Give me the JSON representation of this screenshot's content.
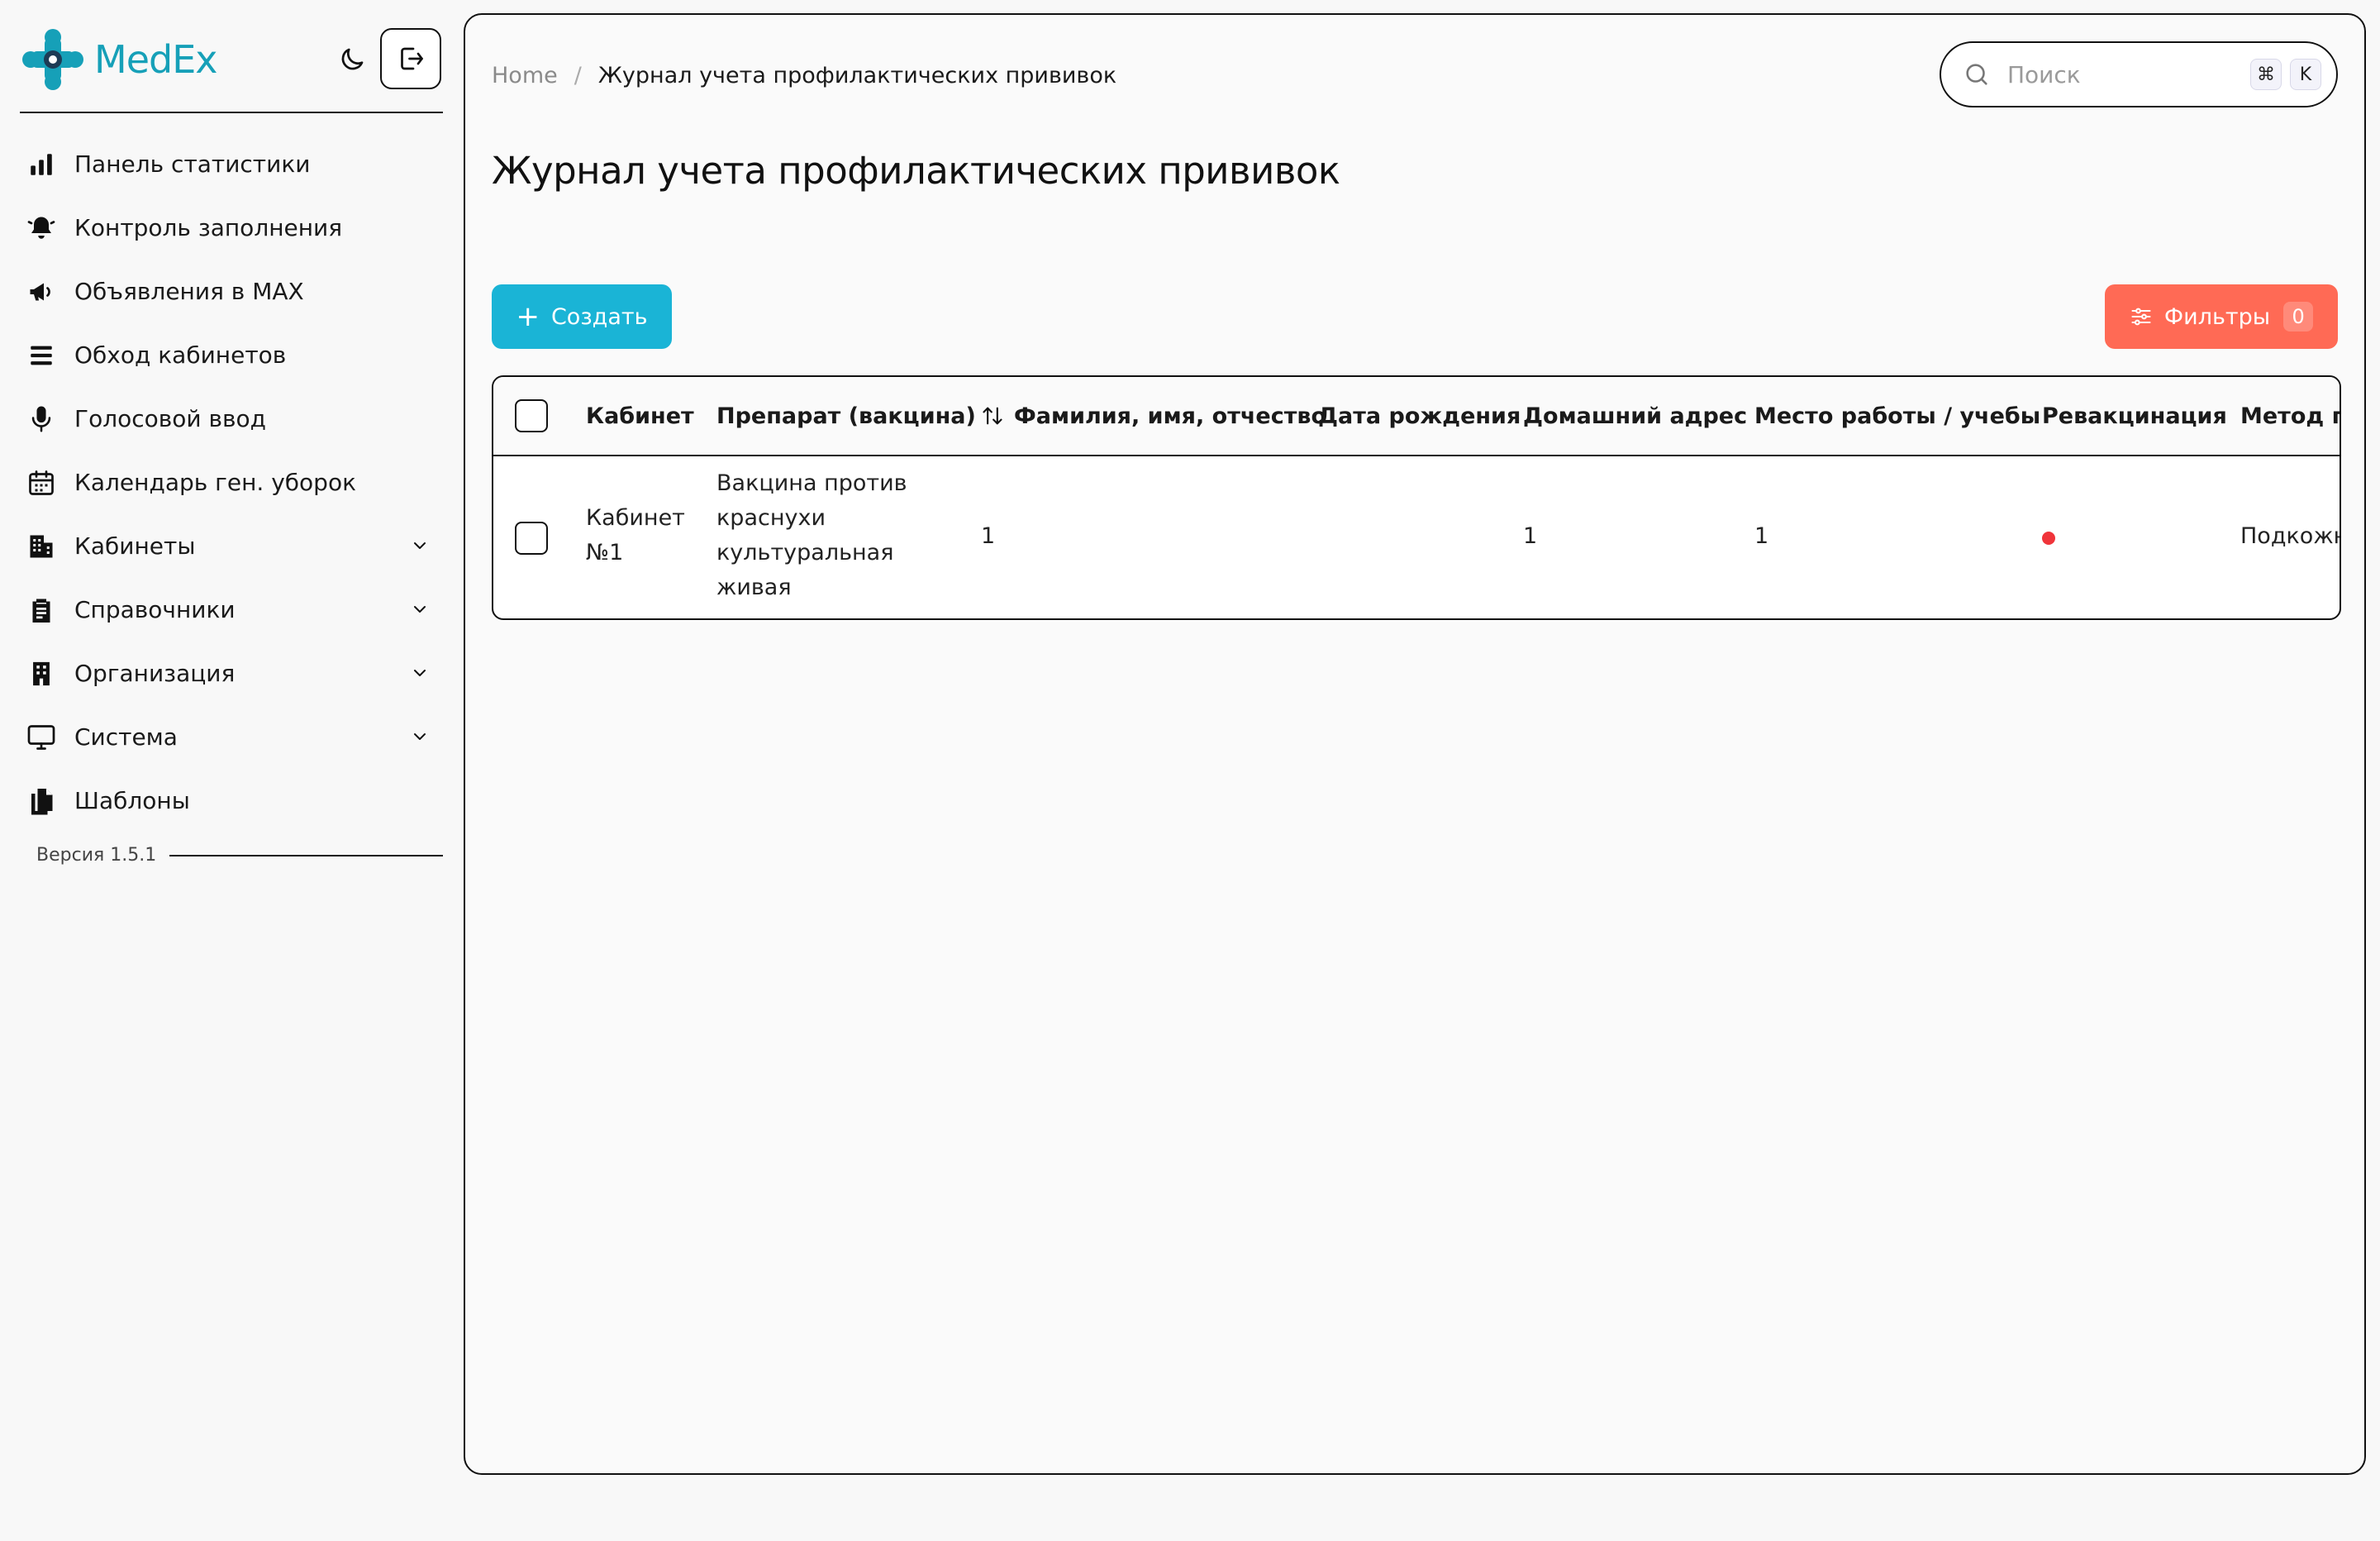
{
  "brand": {
    "name": "MedEx",
    "color": "#16a0b8"
  },
  "sidebar": {
    "items": [
      {
        "label": "Панель статистики",
        "icon": "bar-chart-icon",
        "has_children": false
      },
      {
        "label": "Контроль заполнения",
        "icon": "bell-alert-icon",
        "has_children": false
      },
      {
        "label": "Объявления в MAX",
        "icon": "megaphone-icon",
        "has_children": false
      },
      {
        "label": "Обход кабинетов",
        "icon": "stack-list-icon",
        "has_children": false
      },
      {
        "label": "Голосовой ввод",
        "icon": "microphone-icon",
        "has_children": false
      },
      {
        "label": "Календарь ген. уборок",
        "icon": "calendar-icon",
        "has_children": false
      },
      {
        "label": "Кабинеты",
        "icon": "building-icon",
        "has_children": true
      },
      {
        "label": "Справочники",
        "icon": "clipboard-icon",
        "has_children": true
      },
      {
        "label": "Организация",
        "icon": "office-building-icon",
        "has_children": true
      },
      {
        "label": "Система",
        "icon": "monitor-icon",
        "has_children": true
      },
      {
        "label": "Шаблоны",
        "icon": "documents-icon",
        "has_children": false
      }
    ],
    "version": "Версия 1.5.1"
  },
  "breadcrumb": {
    "home": "Home",
    "separator": "/",
    "current": "Журнал учета профилактических прививок"
  },
  "search": {
    "placeholder": "Поиск",
    "shortcut_mod": "⌘",
    "shortcut_key": "K"
  },
  "page": {
    "title": "Журнал учета профилактических прививок"
  },
  "toolbar": {
    "create_label": "Создать",
    "create_color": "#1ab4d6",
    "filters_label": "Фильтры",
    "filters_count": "0",
    "filters_color": "#ff6a55"
  },
  "table": {
    "columns": [
      "Кабинет",
      "Препарат (вакцина)",
      "Фамилия, имя, отчество",
      "Дата рождения",
      "Домашний адрес",
      "Место работы / учебы",
      "Ревакцинация",
      "Метод пр"
    ],
    "rows": [
      {
        "cabinet": [
          "Кабинет",
          "№1"
        ],
        "vaccine": [
          "Вакцина против",
          "краснухи",
          "культуральная",
          "живая"
        ],
        "full_name": "1",
        "birth_date": "",
        "home_address": "1",
        "workplace": "1",
        "revaccination": false,
        "method": "Подкожно"
      }
    ],
    "status_color_no": "#f0343a"
  }
}
